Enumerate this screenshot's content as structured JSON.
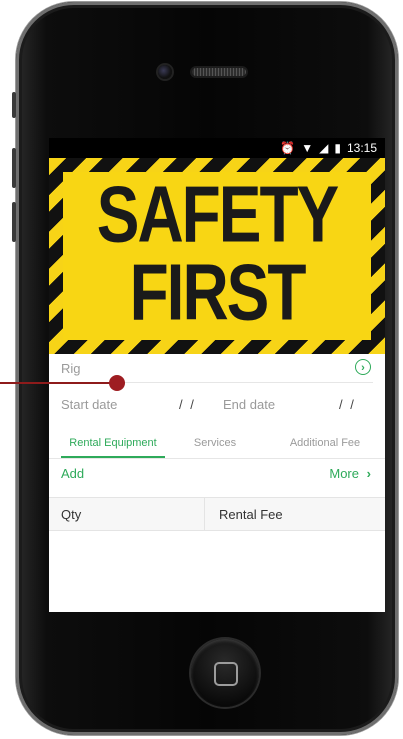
{
  "status_bar": {
    "alarm_icon": "alarm-clock-icon",
    "wifi_icon": "wifi-icon",
    "signal_icon": "signal-icon",
    "battery_icon": "battery-icon",
    "time": "13:15"
  },
  "banner": {
    "line1": "SAFETY",
    "line2": "FIRST",
    "colors": {
      "yellow": "#f8d614",
      "black": "#1a1a1a"
    }
  },
  "form": {
    "rig_label": "Rig",
    "start_date_label": "Start date",
    "start_date_value": "/ /",
    "end_date_label": "End date",
    "end_date_value": "/ /"
  },
  "tabs": [
    {
      "label": "Rental Equipment",
      "active": true
    },
    {
      "label": "Services",
      "active": false
    },
    {
      "label": "Additional Fee",
      "active": false
    }
  ],
  "actions": {
    "add_label": "Add",
    "more_label": "More"
  },
  "table": {
    "columns": [
      "Qty",
      "Rental Fee"
    ]
  },
  "accent_color": "#2eaa5a"
}
